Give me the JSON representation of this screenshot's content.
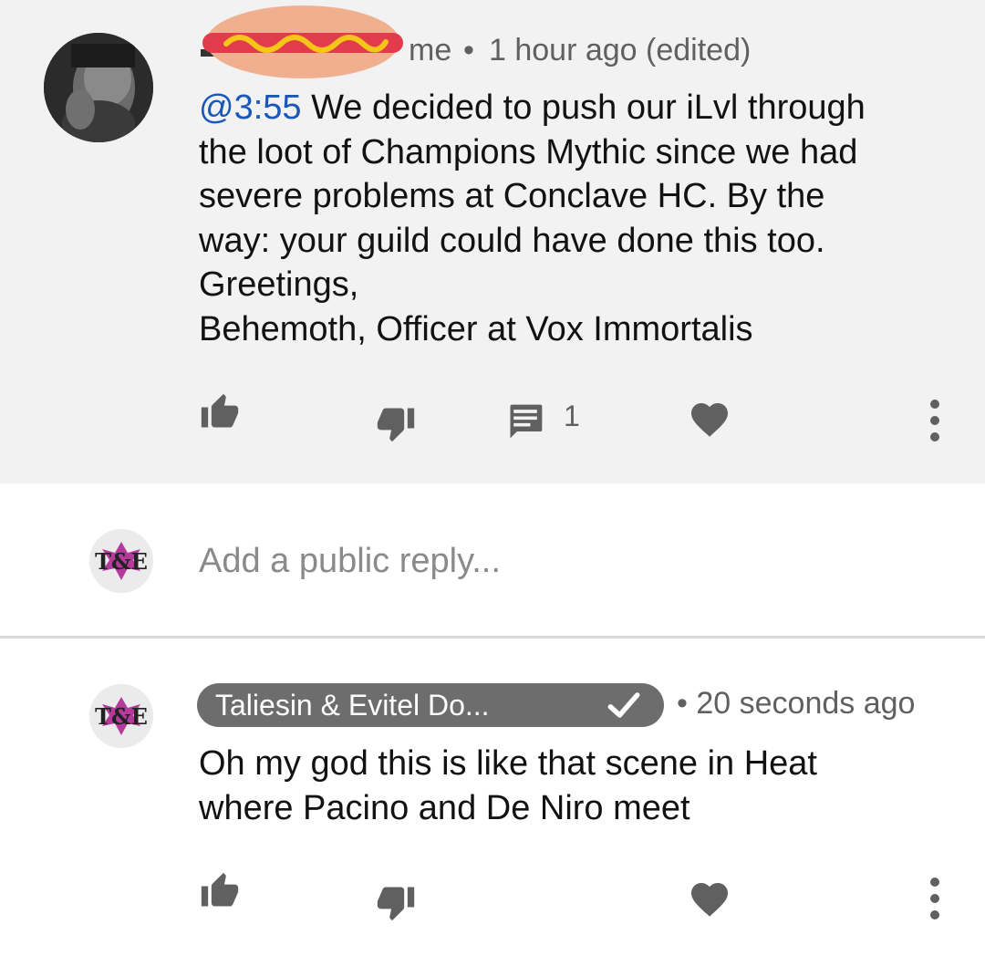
{
  "comment": {
    "author_name_visible_end": "me",
    "separator": "•",
    "time": "1 hour ago (edited)",
    "timestamp_link": "@3:55",
    "body_lines": [
      " We decided to push our iLvl through",
      "the loot of Champions Mythic since we had",
      "severe problems at Conclave HC. By the",
      "way: your guild could have done this too.",
      "Greetings,",
      "Behemoth, Officer at Vox Immortalis"
    ],
    "reply_count": "1",
    "icons": [
      "thumbs-up-icon",
      "thumbs-down-icon",
      "reply-icon",
      "heart-icon",
      "more-vertical-icon"
    ]
  },
  "reply_box": {
    "placeholder": "Add a public reply...",
    "avatar_text": "T&E"
  },
  "reply": {
    "author": "Taliesin & Evitel Do...",
    "separator": "•",
    "time": "20 seconds ago",
    "body_lines": [
      "Oh my god this is like that scene in Heat",
      "where Pacino and De Niro meet"
    ],
    "avatar_text": "T&E",
    "icons": [
      "thumbs-up-icon",
      "thumbs-down-icon",
      "heart-icon",
      "more-vertical-icon"
    ]
  },
  "colors": {
    "timestamp_link": "#1a57b8",
    "author_pill": "#6d6d6d",
    "icon_gray": "#606060",
    "channel_magenta": "#b43a9c",
    "redaction_bun": "#f0b090",
    "redaction_sausage": "#e23b4b",
    "redaction_mustard": "#f5c518"
  }
}
